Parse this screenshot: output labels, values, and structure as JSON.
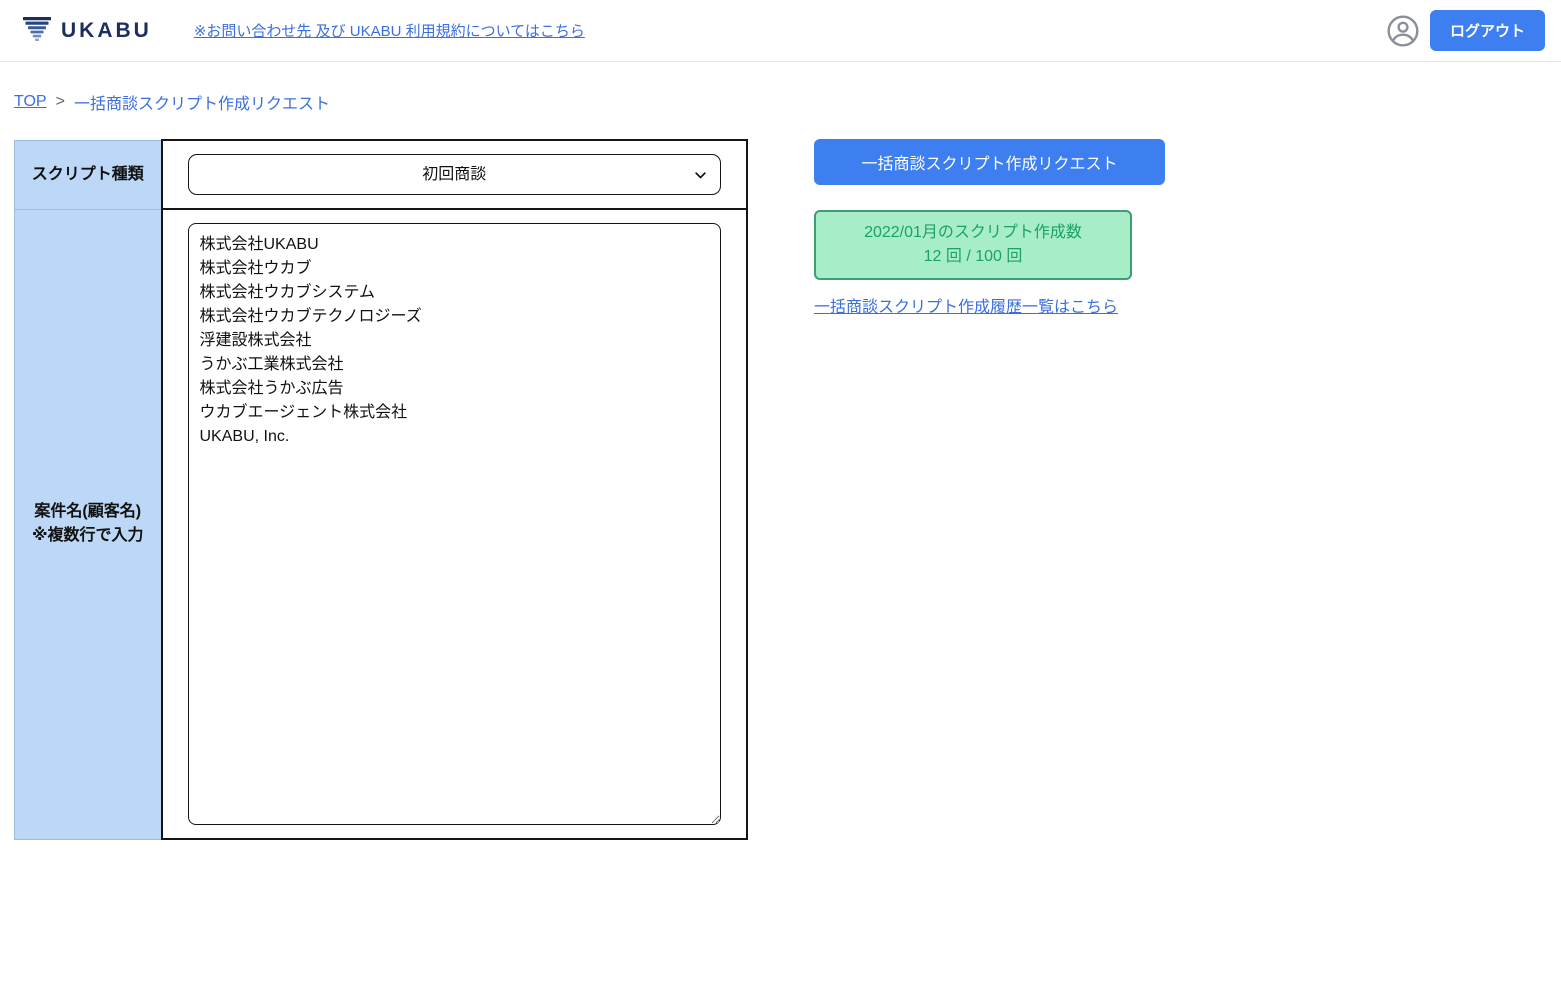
{
  "header": {
    "logo_text": "UKABU",
    "terms_link_label": "※お問い合わせ先 及び UKABU 利用規約についてはこちら",
    "logout_label": "ログアウト"
  },
  "breadcrumb": {
    "top_label": "TOP",
    "separator": ">",
    "current_label": "一括商談スクリプト作成リクエスト"
  },
  "form": {
    "script_type_label": "スクリプト種類",
    "script_type_selected": "初回商談",
    "case_name_label_line1": "案件名(顧客名)",
    "case_name_label_line2": "※複数行で入力",
    "case_names_value": "株式会社UKABU\n株式会社ウカブ\n株式会社ウカブシステム\n株式会社ウカブテクノロジーズ\n浮建設株式会社\nうかぶ工業株式会社\n株式会社うかぶ広告\nウカブエージェント株式会社\nUKABU, Inc."
  },
  "actions": {
    "request_button_label": "一括商談スクリプト作成リクエスト",
    "quota_title": "2022/01月のスクリプト作成数",
    "quota_count": "12 回 / 100 回",
    "history_link_label": "一括商談スクリプト作成履歴一覧はこちら"
  },
  "icons": {
    "logo_mark": "funnel-bars-icon",
    "avatar": "account-circle-icon",
    "select_chevron": "chevron-down-icon"
  },
  "colors": {
    "brand_navy": "#1b2e5e",
    "accent_blue": "#3d7ef0",
    "link_blue": "#3b6fe0",
    "cell_blue": "#bcd8f6",
    "quota_bg_green": "#a7edc8",
    "quota_border_green": "#3f9e71",
    "quota_text_green": "#1ca265"
  }
}
